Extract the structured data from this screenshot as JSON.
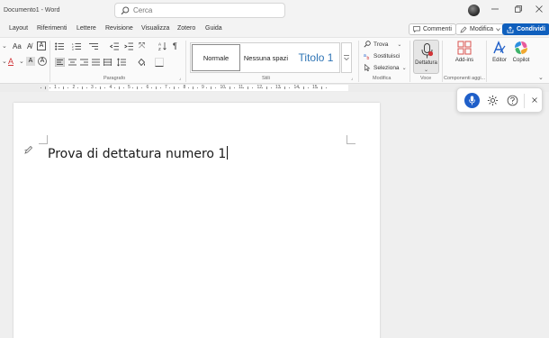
{
  "window": {
    "title": "Documento1  -  Word",
    "search_placeholder": "Cerca"
  },
  "menu": {
    "tabs": [
      "Layout",
      "Riferimenti",
      "Lettere",
      "Revisione",
      "Visualizza",
      "Zotero",
      "Guida"
    ],
    "comments": "Commenti",
    "edit": "Modifica",
    "share": "Condividi"
  },
  "ribbon": {
    "groups": {
      "paragraph": "Paragrafo",
      "styles": "Stili",
      "editing": "Modifica",
      "voice": "Voce",
      "addins": "Componenti aggi..."
    },
    "styles": [
      "Normale",
      "Nessuna spazi",
      "Titolo 1"
    ],
    "editing_items": [
      "Trova",
      "Sostituisci",
      "Seleziona"
    ],
    "dictate": "Dettatura",
    "addins_btn": "Add-ins",
    "editor_btn": "Editor",
    "copilot_btn": "Copilot"
  },
  "ruler_numbers": [
    "1",
    "2",
    "3",
    "4",
    "5",
    "6",
    "7",
    "8",
    "9",
    "10",
    "11",
    "12",
    "13",
    "14",
    "15"
  ],
  "document": {
    "text": "Prova di dettatura numero 1"
  },
  "colors": {
    "accent": "#0f5fbd",
    "heading": "#2e74b5",
    "dictate_red": "#d13438",
    "mic_blue": "#1f5fc9"
  }
}
